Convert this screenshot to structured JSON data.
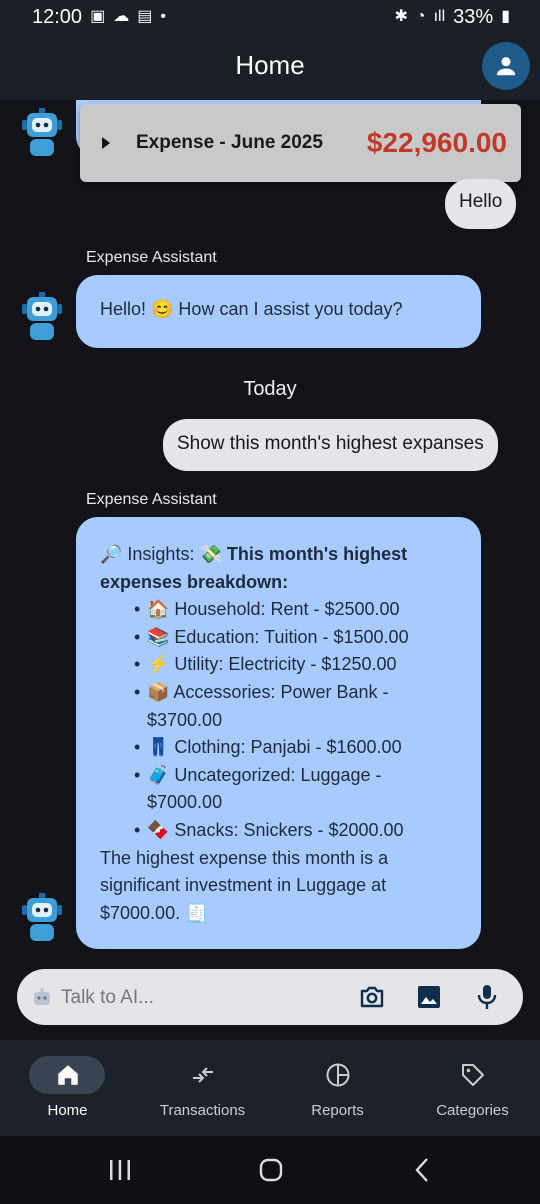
{
  "status_bar": {
    "time": "12:00",
    "battery": "33%"
  },
  "app_bar": {
    "title": "Home"
  },
  "expense_card": {
    "title": "Expense - June 2025",
    "amount": "$22,960.00"
  },
  "messages": {
    "user_hello": "Hello",
    "assistant_name": "Expense Assistant",
    "assistant_greeting": "Hello! 😊 How can I assist you today?",
    "date_separator": "Today",
    "user_query": "Show this month's highest expanses",
    "assistant_name_2": "Expense Assistant",
    "insights_prefix": "🔎 Insights: 💸 ",
    "insights_heading": "This month's highest expenses breakdown:",
    "items": [
      "🏠 Household: Rent - $2500.00",
      "📚 Education: Tuition - $1500.00",
      "⚡ Utility: Electricity - $1250.00",
      "📦 Accessories: Power Bank - $3700.00",
      "👖 Clothing: Panjabi - $1600.00",
      "🧳 Uncategorized: Luggage - $7000.00",
      "🍫 Snacks: Snickers - $2000.00"
    ],
    "insights_summary": "The highest expense this month is a significant investment in Luggage at $7000.00. 🧾"
  },
  "composer": {
    "placeholder": "Talk to AI..."
  },
  "bottom_nav": {
    "items": [
      {
        "label": "Home",
        "icon": "home-icon",
        "active": true
      },
      {
        "label": "Transactions",
        "icon": "transactions-icon",
        "active": false
      },
      {
        "label": "Reports",
        "icon": "reports-icon",
        "active": false
      },
      {
        "label": "Categories",
        "icon": "categories-icon",
        "active": false
      }
    ]
  },
  "colors": {
    "bot_bubble": "#a8cbff",
    "user_bubble": "#e4e4e9",
    "amount": "#c0392b",
    "background": "#12141a"
  }
}
